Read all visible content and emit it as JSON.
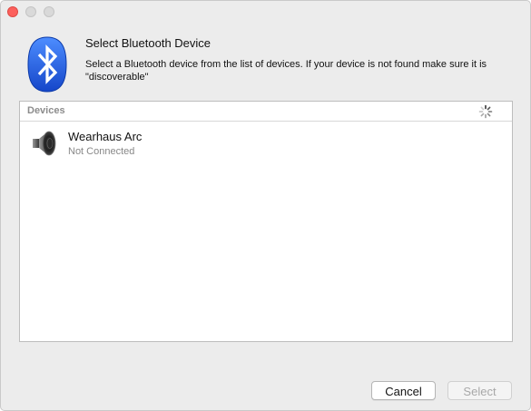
{
  "dialog": {
    "heading": "Select Bluetooth Device",
    "description": "Select a Bluetooth device from the list of devices. If your device is not found make sure it is \"discoverable\"",
    "bluetooth_icon": "bluetooth-icon",
    "bluetooth_color": "#1f5fe0"
  },
  "devices_panel": {
    "header_label": "Devices",
    "spinner_icon": "loading-spinner-icon",
    "items": [
      {
        "name": "Wearhaus Arc",
        "status": "Not Connected",
        "icon": "speaker-icon"
      }
    ]
  },
  "buttons": {
    "cancel_label": "Cancel",
    "select_label": "Select"
  },
  "window_controls": {
    "close_color": "#fc605c",
    "inactive_color": "#d9d9d9"
  }
}
